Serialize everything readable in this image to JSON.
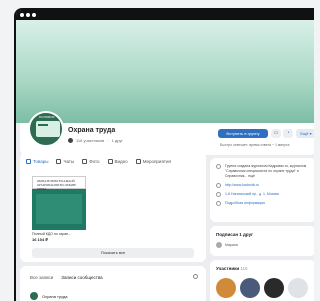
{
  "group": {
    "name": "Охрана труда",
    "members": "116 участников",
    "age": "1 друг",
    "avatar_caption": "КОЛОБОК"
  },
  "header": {
    "join_label": "Вступить в группу",
    "more_label": "Ещё",
    "note": "Быстро отвечает: время ответа ~ 1 минута"
  },
  "tabs": [
    {
      "label": "Товары",
      "icon": "bag-icon"
    },
    {
      "label": "Чаты",
      "icon": "chat-icon"
    },
    {
      "label": "Фото",
      "icon": "photo-icon"
    },
    {
      "label": "Видео",
      "icon": "video-icon"
    },
    {
      "label": "Мероприятия",
      "icon": "calendar-icon"
    }
  ],
  "product": {
    "cover_title": "ОБЯЗАТЕЛЬНО В КАЖДОЙ ОРГАНИЗАЦИИ ВО ОХРАНЕ ТРУДА",
    "name": "Полный КДО по охран...",
    "price": "16 104 ₽"
  },
  "show_all": "Показать все",
  "wall": {
    "all_posts": "Все записи",
    "community_posts": "Записи сообщества"
  },
  "post": {
    "author": "Охрана труда"
  },
  "info": {
    "description": "Группа создана журналом Кадровик.ru, журналом \"Справочник специалиста по охране труда\" и Справочник... ещё",
    "website": "http://www.kadrovik.ru",
    "address": "1-й Нагатинский пр., д. 1, Москва",
    "more": "Подробная информация"
  },
  "subscribers": {
    "title": "Подписан 1 друг",
    "friend": "Марина"
  },
  "participants": {
    "title": "Участники",
    "count": "116"
  },
  "colors": {
    "accent": "#2f6fc1",
    "cover_top": "#d9f0e9",
    "cover_bottom": "#7cbda6",
    "brand_green": "#2d6b52"
  }
}
